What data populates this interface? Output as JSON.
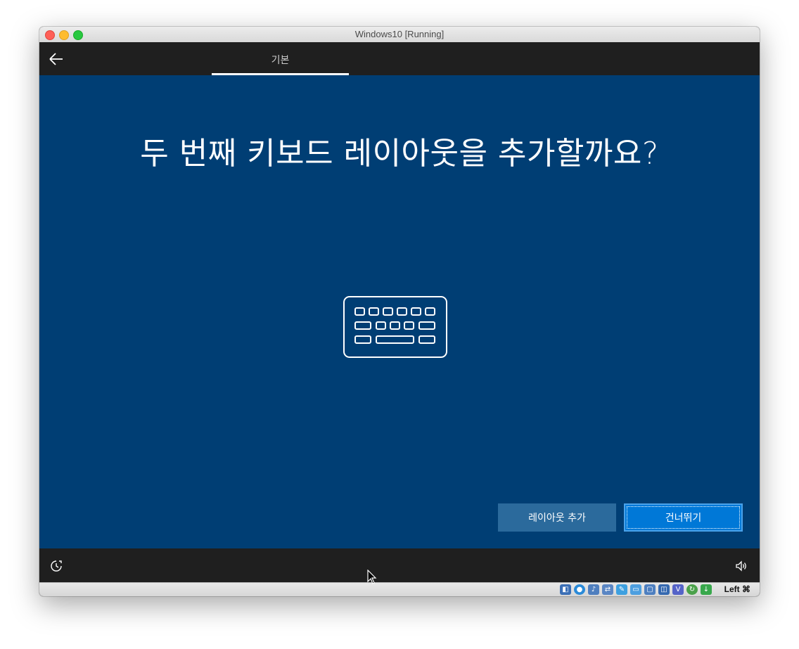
{
  "window": {
    "title": "Windows10 [Running]"
  },
  "topbar": {
    "back_icon": "back-arrow-icon",
    "tabs": [
      {
        "label": "기본",
        "selected": true
      }
    ]
  },
  "main": {
    "heading": "두 번째 키보드 레이아웃을 추가할까요?",
    "illustration_icon": "keyboard-icon",
    "background_color": "#003e74"
  },
  "actions": {
    "add_layout_label": "레이아웃 추가",
    "skip_label": "건너뛰기",
    "skip_color": "#0078d7",
    "add_color": "#2b6a9c"
  },
  "bottombar": {
    "accessibility_icon": "ease-of-access-icon",
    "volume_icon": "speaker-icon"
  },
  "statusbar": {
    "icons": [
      "hard-disk-icon",
      "optical-drive-icon",
      "audio-icon",
      "network-icon",
      "usb-icon",
      "shared-folders-icon",
      "display-icon",
      "recording-icon",
      "virtualbox-icon",
      "mouse-integration-icon",
      "download-icon"
    ],
    "host_key": "Left ⌘"
  }
}
